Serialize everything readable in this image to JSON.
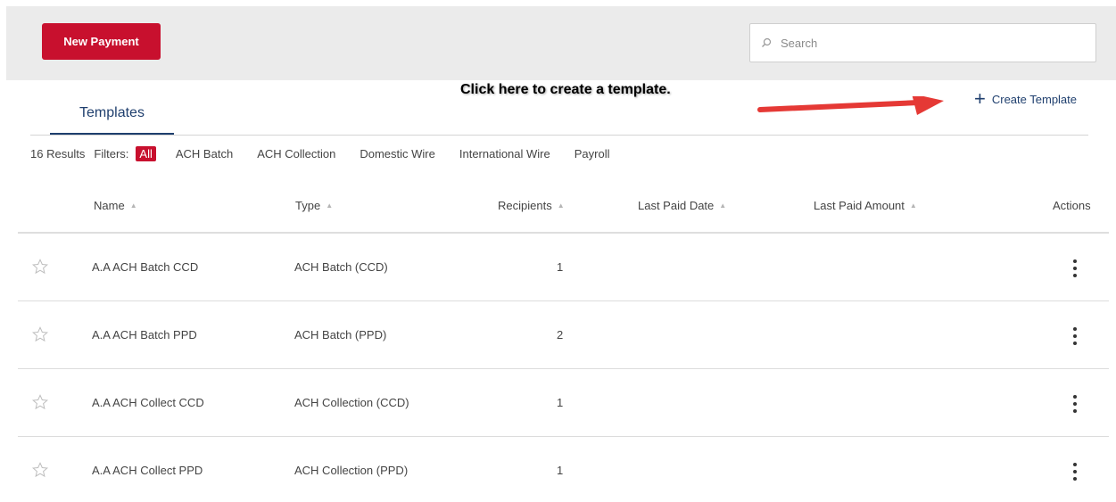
{
  "header": {
    "new_payment_label": "New Payment",
    "search_placeholder": "Search"
  },
  "annotation": {
    "text": "Click here to create a template.",
    "arrow_color": "#e53935"
  },
  "create_template_label": "Create Template",
  "tabs": [
    {
      "label": "Templates",
      "active": true
    }
  ],
  "filters": {
    "results_text": "16 Results",
    "label": "Filters:",
    "items": [
      {
        "label": "All",
        "active": true
      },
      {
        "label": "ACH Batch",
        "active": false
      },
      {
        "label": "ACH Collection",
        "active": false
      },
      {
        "label": "Domestic Wire",
        "active": false
      },
      {
        "label": "International Wire",
        "active": false
      },
      {
        "label": "Payroll",
        "active": false
      }
    ]
  },
  "table": {
    "columns": [
      "Name",
      "Type",
      "Recipients",
      "Last Paid Date",
      "Last Paid Amount",
      "Actions"
    ],
    "rows": [
      {
        "name": "A.A ACH Batch CCD",
        "type": "ACH Batch (CCD)",
        "recipients": "1",
        "last_paid_date": "",
        "last_paid_amount": ""
      },
      {
        "name": "A.A ACH Batch PPD",
        "type": "ACH Batch (PPD)",
        "recipients": "2",
        "last_paid_date": "",
        "last_paid_amount": ""
      },
      {
        "name": "A.A ACH Collect CCD",
        "type": "ACH Collection (CCD)",
        "recipients": "1",
        "last_paid_date": "",
        "last_paid_amount": ""
      },
      {
        "name": "A.A ACH Collect PPD",
        "type": "ACH Collection (PPD)",
        "recipients": "1",
        "last_paid_date": "",
        "last_paid_amount": ""
      }
    ]
  },
  "colors": {
    "brand_red": "#c8102e",
    "navy": "#1f3f6e"
  }
}
